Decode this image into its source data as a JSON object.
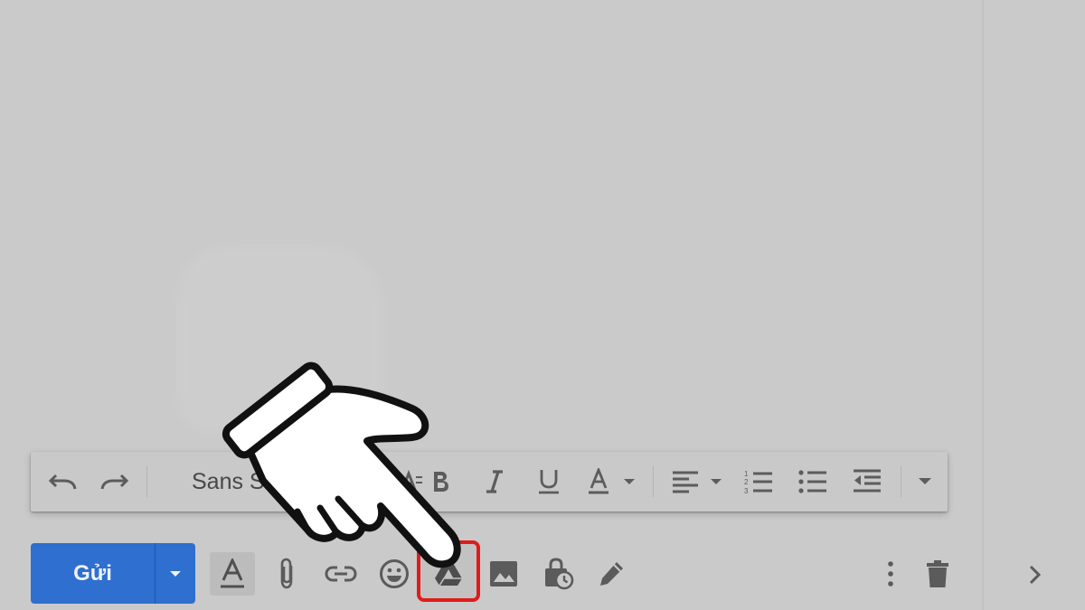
{
  "compose": {
    "send_label": "Gửi",
    "accent_color": "#2e6fcf",
    "highlight_color": "#e01b1b"
  },
  "format_toolbar": {
    "font_name": "Sans Serif",
    "buttons": [
      "undo-icon",
      "redo-icon",
      "font-select",
      "font-size-icon",
      "bold-icon",
      "italic-icon",
      "underline-icon",
      "text-color-icon",
      "align-icon",
      "numbered-list-icon",
      "bulleted-list-icon",
      "indent-less-icon",
      "more-formatting-icon"
    ]
  },
  "action_bar": {
    "buttons": [
      "formatting-options-icon",
      "attach-icon",
      "link-icon",
      "emoji-icon",
      "google-drive-icon",
      "photo-icon",
      "confidential-mode-icon",
      "signature-icon",
      "more-options-icon",
      "discard-draft-icon"
    ],
    "highlighted": "google-drive-icon"
  },
  "overlay": {
    "pointer": "hand-pointer-icon"
  }
}
